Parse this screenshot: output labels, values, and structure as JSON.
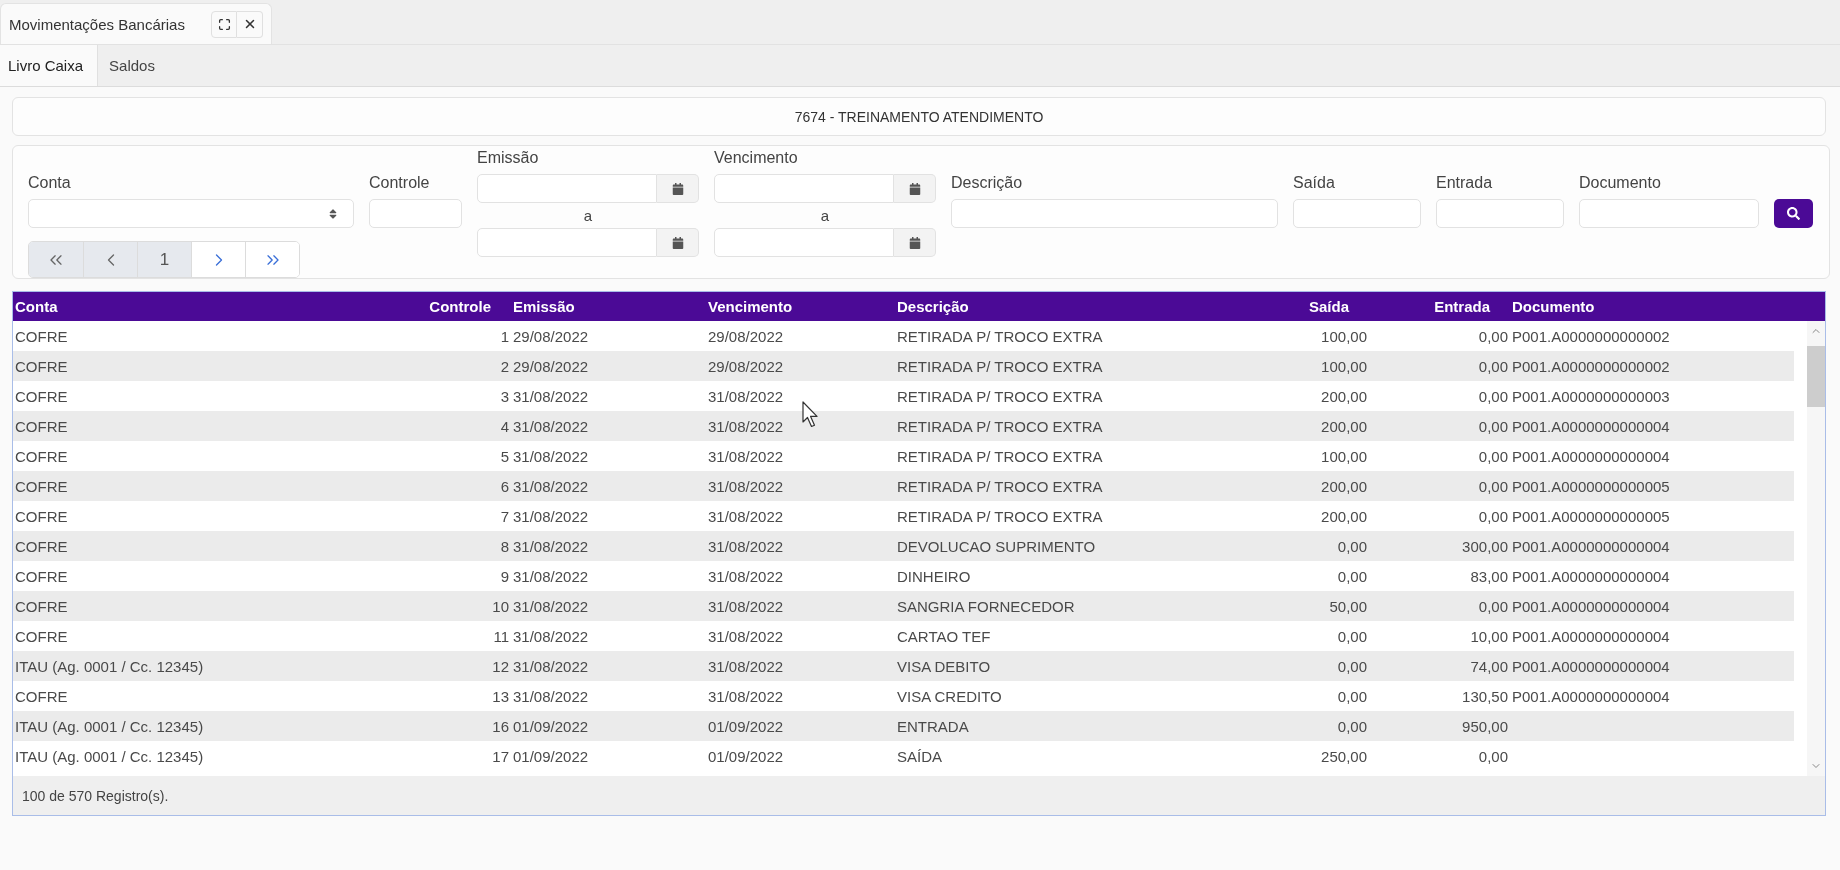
{
  "window_tab": {
    "title": "Movimentações Bancárias"
  },
  "tabs": [
    {
      "label": "Livro Caixa",
      "selected": true
    },
    {
      "label": "Saldos",
      "selected": false
    }
  ],
  "company": {
    "name": "7674 - TREINAMENTO ATENDIMENTO"
  },
  "filters": [
    {
      "kind": "select",
      "label": "Conta"
    },
    {
      "kind": "text",
      "label": "Controle"
    },
    {
      "kind": "date_range",
      "label": "Emissão",
      "separator": "a"
    },
    {
      "kind": "date_range",
      "label": "Vencimento",
      "separator": "a"
    },
    {
      "kind": "text",
      "label": "Descrição"
    },
    {
      "kind": "text",
      "label": "Saída"
    },
    {
      "kind": "text",
      "label": "Entrada"
    },
    {
      "kind": "text",
      "label": "Documento"
    }
  ],
  "pagination": [
    {
      "kind": "first",
      "disabled": true
    },
    {
      "kind": "previous",
      "disabled": true
    },
    {
      "kind": "page",
      "label": "1",
      "selected": true
    },
    {
      "kind": "next",
      "disabled": false
    },
    {
      "kind": "last",
      "disabled": false
    }
  ],
  "table": {
    "columns": [
      {
        "label": "Conta",
        "kind": "text"
      },
      {
        "label": "Controle",
        "kind": "number"
      },
      {
        "label": "Emissão",
        "kind": "date"
      },
      {
        "label": "Vencimento",
        "kind": "date"
      },
      {
        "label": "Descrição",
        "kind": "text"
      },
      {
        "label": "Saída",
        "kind": "number"
      },
      {
        "label": "Entrada",
        "kind": "number"
      },
      {
        "label": "Documento",
        "kind": "text"
      }
    ],
    "rows": [
      {
        "cells": [
          "COFRE",
          "1",
          "29/08/2022",
          "29/08/2022",
          "RETIRADA P/ TROCO EXTRA",
          "100,00",
          "0,00",
          "P001.A0000000000002"
        ]
      },
      {
        "cells": [
          "COFRE",
          "2",
          "29/08/2022",
          "29/08/2022",
          "RETIRADA P/ TROCO EXTRA",
          "100,00",
          "0,00",
          "P001.A0000000000002"
        ]
      },
      {
        "cells": [
          "COFRE",
          "3",
          "31/08/2022",
          "31/08/2022",
          "RETIRADA P/ TROCO EXTRA",
          "200,00",
          "0,00",
          "P001.A0000000000003"
        ]
      },
      {
        "cells": [
          "COFRE",
          "4",
          "31/08/2022",
          "31/08/2022",
          "RETIRADA P/ TROCO EXTRA",
          "200,00",
          "0,00",
          "P001.A0000000000004"
        ]
      },
      {
        "cells": [
          "COFRE",
          "5",
          "31/08/2022",
          "31/08/2022",
          "RETIRADA P/ TROCO EXTRA",
          "100,00",
          "0,00",
          "P001.A0000000000004"
        ]
      },
      {
        "cells": [
          "COFRE",
          "6",
          "31/08/2022",
          "31/08/2022",
          "RETIRADA P/ TROCO EXTRA",
          "200,00",
          "0,00",
          "P001.A0000000000005"
        ]
      },
      {
        "cells": [
          "COFRE",
          "7",
          "31/08/2022",
          "31/08/2022",
          "RETIRADA P/ TROCO EXTRA",
          "200,00",
          "0,00",
          "P001.A0000000000005"
        ]
      },
      {
        "cells": [
          "COFRE",
          "8",
          "31/08/2022",
          "31/08/2022",
          "DEVOLUCAO SUPRIMENTO",
          "0,00",
          "300,00",
          "P001.A0000000000004"
        ]
      },
      {
        "cells": [
          "COFRE",
          "9",
          "31/08/2022",
          "31/08/2022",
          "DINHEIRO",
          "0,00",
          "83,00",
          "P001.A0000000000004"
        ]
      },
      {
        "cells": [
          "COFRE",
          "10",
          "31/08/2022",
          "31/08/2022",
          "SANGRIA FORNECEDOR",
          "50,00",
          "0,00",
          "P001.A0000000000004"
        ]
      },
      {
        "cells": [
          "COFRE",
          "11",
          "31/08/2022",
          "31/08/2022",
          "CARTAO TEF",
          "0,00",
          "10,00",
          "P001.A0000000000004"
        ]
      },
      {
        "cells": [
          "ITAU (Ag. 0001 / Cc. 12345)",
          "12",
          "31/08/2022",
          "31/08/2022",
          "VISA DEBITO",
          "0,00",
          "74,00",
          "P001.A0000000000004"
        ]
      },
      {
        "cells": [
          "COFRE",
          "13",
          "31/08/2022",
          "31/08/2022",
          "VISA CREDITO",
          "0,00",
          "130,50",
          "P001.A0000000000004"
        ]
      },
      {
        "cells": [
          "ITAU (Ag. 0001 / Cc. 12345)",
          "16",
          "01/09/2022",
          "01/09/2022",
          "ENTRADA",
          "0,00",
          "950,00"
        ]
      },
      {
        "cells": [
          "ITAU (Ag. 0001 / Cc. 12345)",
          "17",
          "01/09/2022",
          "01/09/2022",
          "SAÍDA",
          "250,00",
          "0,00"
        ]
      }
    ]
  },
  "status_bar": {
    "text": "100 de 570 Registro(s)."
  }
}
